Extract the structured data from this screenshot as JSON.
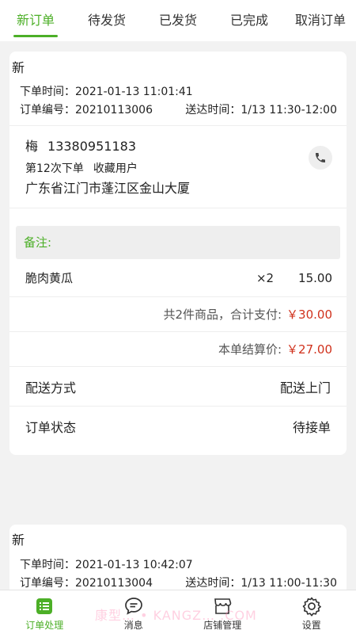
{
  "tabs": [
    {
      "label": "新订单",
      "active": true
    },
    {
      "label": "待发货"
    },
    {
      "label": "已发货"
    },
    {
      "label": "已完成"
    },
    {
      "label": "取消订单"
    }
  ],
  "orders": [
    {
      "status": "新",
      "order_time_label": "下单时间：",
      "order_time": "2021-01-13 11:01:41",
      "order_no_label": "订单编号：",
      "order_no": "20210113006",
      "delivery_time_label": "送达时间：",
      "delivery_time": "1/13 11:30-12:00",
      "customer": {
        "name": "梅",
        "phone": "13380951183",
        "order_count": "第12次下单",
        "tag": "收藏用户",
        "address": "广东省江门市蓬江区金山大厦"
      },
      "remark_label": "备注:",
      "items": [
        {
          "name": "脆肉黄瓜",
          "qty": "×2",
          "price": "15.00"
        }
      ],
      "total_text": "共2件商品，合计支付:",
      "total": "￥30.00",
      "settle_text": "本单结算价:",
      "settle": "￥27.00",
      "delivery_method_label": "配送方式",
      "delivery_method": "配送上门",
      "order_status_label": "订单状态",
      "order_status": "待接单"
    },
    {
      "status": "新",
      "order_time_label": "下单时间：",
      "order_time": "2021-01-13 10:42:07",
      "order_no_label": "订单编号：",
      "order_no": "20210113004",
      "delivery_time_label": "送达时间：",
      "delivery_time": "1/13 11:00-11:30"
    }
  ],
  "bottom_nav": [
    {
      "label": "订单处理",
      "icon": "list-icon",
      "active": true
    },
    {
      "label": "消息",
      "icon": "chat-icon"
    },
    {
      "label": "店铺管理",
      "icon": "store-icon"
    },
    {
      "label": "设置",
      "icon": "gear-icon"
    }
  ],
  "watermark": "康型… • KANGZ… .COM",
  "colors": {
    "accent": "#4caf27",
    "price": "#d0311c"
  }
}
